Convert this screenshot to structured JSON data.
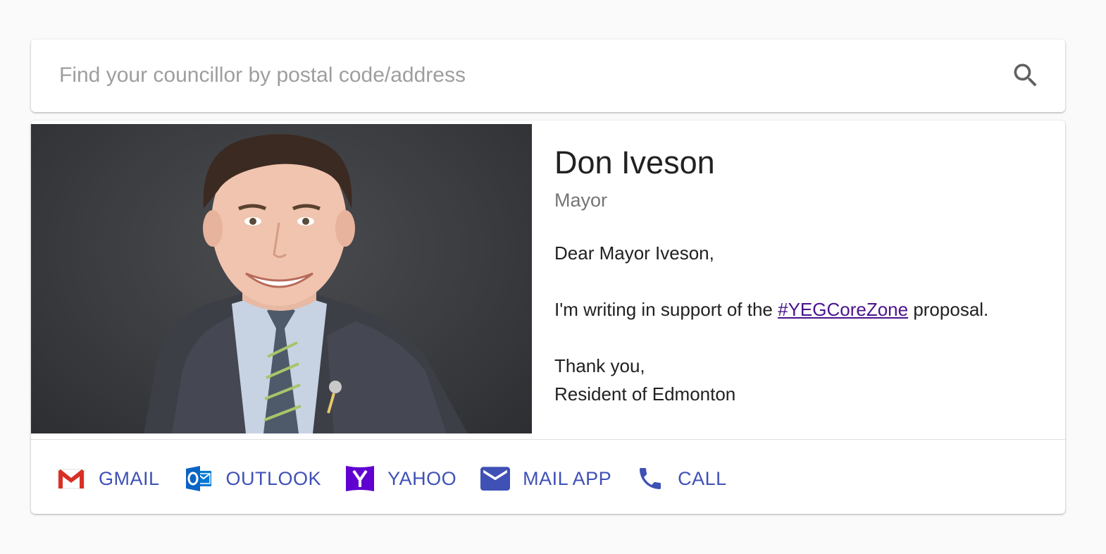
{
  "search": {
    "placeholder": "Find your councillor by postal code/address",
    "value": "",
    "icon": "search-icon"
  },
  "councillor": {
    "name": "Don Iveson",
    "role": "Mayor",
    "photo_icon": "portrait-photo"
  },
  "letter": {
    "greeting": "Dear Mayor Iveson,",
    "body_prefix": "I'm writing in support of the ",
    "hashtag": "#YEGCoreZone",
    "body_suffix": " proposal.",
    "closing": "Thank you,",
    "signature": "Resident of Edmonton"
  },
  "actions": [
    {
      "label": "GMAIL",
      "icon": "gmail-icon"
    },
    {
      "label": "OUTLOOK",
      "icon": "outlook-icon"
    },
    {
      "label": "YAHOO",
      "icon": "yahoo-icon"
    },
    {
      "label": "MAIL APP",
      "icon": "mail-icon"
    },
    {
      "label": "CALL",
      "icon": "phone-icon"
    }
  ],
  "colors": {
    "accent": "#3f51b5",
    "link": "#4a148c",
    "secondary_text": "#757575",
    "placeholder": "#9e9e9e",
    "gmail_red": "#d93025",
    "outlook_blue": "#0078d4",
    "yahoo_purple": "#5f01d1"
  }
}
